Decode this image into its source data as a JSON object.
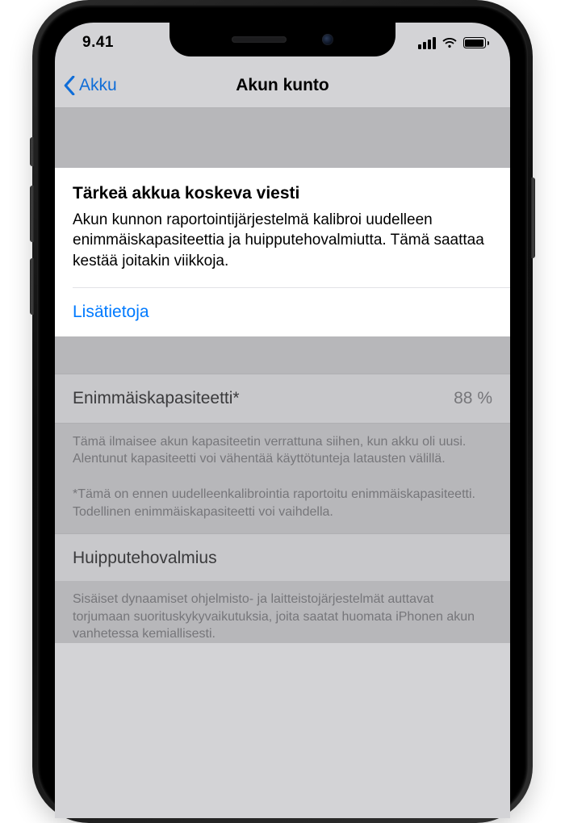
{
  "status": {
    "time": "9.41"
  },
  "nav": {
    "back_label": "Akku",
    "title": "Akun kunto"
  },
  "message_card": {
    "title": "Tärkeä akkua koskeva viesti",
    "body": "Akun kunnon raportointijärjestelmä kalibroi uudelleen enimmäiskapasiteettia ja huipputehovalmiutta. Tämä saattaa kestää joitakin viikkoja.",
    "learn_more": "Lisätietoja"
  },
  "capacity": {
    "label": "Enimmäiskapasiteetti*",
    "value": "88 %",
    "description_p1": "Tämä ilmaisee akun kapasiteetin verrattuna siihen, kun akku oli uusi. Alentunut kapasiteetti voi vähentää käyttötunteja latausten välillä.",
    "description_p2": "*Tämä on ennen uudelleenkalibrointia raportoitu enimmäiskapasiteetti. Todellinen enimmäiskapasiteetti voi vaihdella."
  },
  "peak": {
    "label": "Huipputehovalmius",
    "description": "Sisäiset dynaamiset ohjelmisto- ja laitteistojärjestelmät auttavat torjumaan suorituskykyvaikutuksia, joita saatat huomata iPhonen akun vanhetessa kemiallisesti."
  }
}
